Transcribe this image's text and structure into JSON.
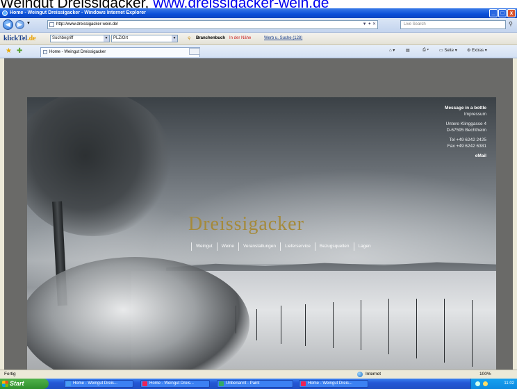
{
  "caption": {
    "text": "Weingut Dreissigacker, ",
    "link": "www.dreissigacker-wein.de"
  },
  "window": {
    "title": "Home - Weingut Dreissigacker - Windows Internet Explorer",
    "buttons": [
      "_",
      "□",
      "x"
    ]
  },
  "address_bar": {
    "url": "http://www.dreissigacker-wein.de/",
    "controls": "▼ ✦ ✕",
    "search_placeholder": "Live Search"
  },
  "klicktel_toolbar": {
    "logo_main": "klickTel",
    "logo_suffix": ".de",
    "search_term": "Suchbegriff",
    "location": "PLZ/Ort",
    "branchenbuch": "Branchenbuch",
    "in_der_naehe": "In der Nähe",
    "werbung": "Werb u. Suche (128)"
  },
  "favorites_bar": {
    "tab_label": "Home - Weingut Dreissigacker",
    "command_items": [
      "Seite",
      "Extras"
    ]
  },
  "site": {
    "brand": "Dreissigacker",
    "menu": [
      "Weingut",
      "Weine",
      "Veranstaltungen",
      "Lieferservice",
      "Bezugsquellen",
      "Lagen"
    ],
    "info": {
      "line1": "Message in a bottle",
      "line2": "Impressum",
      "addr1": "Untere Klinggasse 4",
      "addr2": "D-67595 Bechtheim",
      "tel": "Tel +49 6242 2425",
      "fax": "Fax +49 6242 6381",
      "mail": "eMail"
    }
  },
  "status_bar": {
    "left": "Fertig",
    "zone": "Internet",
    "zoom": "100%"
  },
  "taskbar": {
    "start": "Start",
    "buttons": [
      "Home - Weingut Dreis...",
      "Home - Weingut Dreis...",
      "Unbenannt - Paint",
      "Home - Weingut Dreis..."
    ],
    "clock": "11:02"
  }
}
